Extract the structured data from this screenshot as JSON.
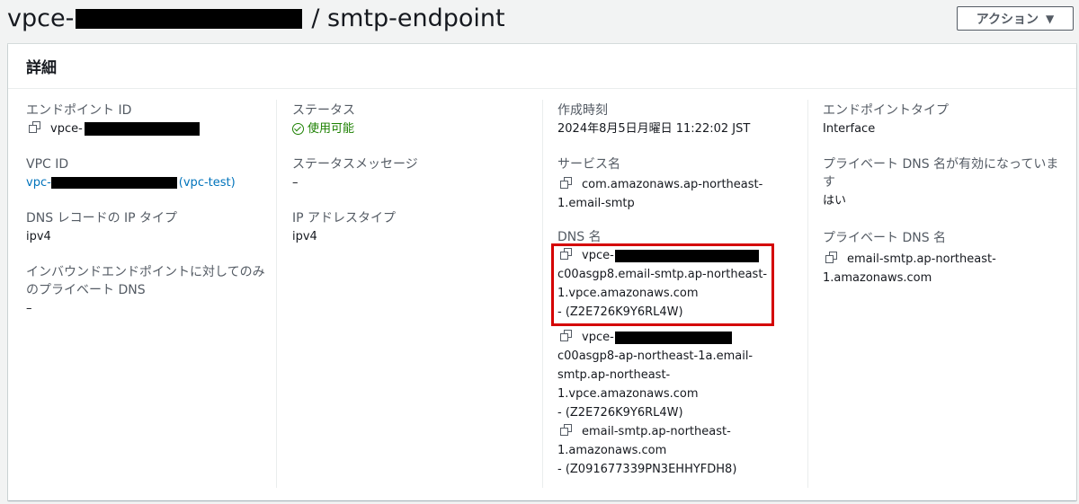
{
  "header": {
    "title_prefix": "vpce-",
    "title_suffix": "/ smtp-endpoint",
    "action_label": "アクション",
    "action_caret": "▼"
  },
  "panel": {
    "title": "詳細"
  },
  "col1": {
    "endpoint_id_label": "エンドポイント ID",
    "endpoint_id_value": "vpce-",
    "vpc_id_label": "VPC ID",
    "vpc_id_prefix": "vpc-",
    "vpc_id_suffix": "(vpc-test)",
    "dns_record_ip_type_label": "DNS レコードの IP タイプ",
    "dns_record_ip_type_value": "ipv4",
    "inbound_private_dns_label": "インバウンドエンドポイントに対してのみのプライベート DNS",
    "inbound_private_dns_value": "–"
  },
  "col2": {
    "status_label": "ステータス",
    "status_value": "使用可能",
    "status_message_label": "ステータスメッセージ",
    "status_message_value": "–",
    "ip_address_type_label": "IP アドレスタイプ",
    "ip_address_type_value": "ipv4"
  },
  "col3": {
    "created_label": "作成時刻",
    "created_value": "2024年8月5日月曜日 11:22:02 JST",
    "service_name_label": "サービス名",
    "service_name_line1": "com.amazonaws.ap-northeast-",
    "service_name_line2": "1.email-smtp",
    "dns_names_label": "DNS 名",
    "dns_names": [
      {
        "prefix": "vpce-",
        "lines": [
          "c00asgp8.email-smtp.ap-northeast-",
          "1.vpce.amazonaws.com",
          "- (Z2E726K9Y6RL4W)"
        ]
      },
      {
        "prefix": "vpce-",
        "lines": [
          "c00asgp8-ap-northeast-1a.email-",
          "smtp.ap-northeast-",
          "1.vpce.amazonaws.com",
          "- (Z2E726K9Y6RL4W)"
        ]
      },
      {
        "prefix": "email-smtp.ap-northeast-",
        "lines": [
          "1.amazonaws.com",
          "- (Z091677339PN3EHHYFDH8)"
        ]
      }
    ]
  },
  "col4": {
    "endpoint_type_label": "エンドポイントタイプ",
    "endpoint_type_value": "Interface",
    "private_dns_enabled_label": "プライベート DNS 名が有効になっています",
    "private_dns_enabled_value": "はい",
    "private_dns_name_label": "プライベート DNS 名",
    "private_dns_name_line1": "email-smtp.ap-northeast-",
    "private_dns_name_line2": "1.amazonaws.com"
  },
  "colors": {
    "link": "#0073bb",
    "success": "#1d8102",
    "highlight": "#d40000"
  }
}
